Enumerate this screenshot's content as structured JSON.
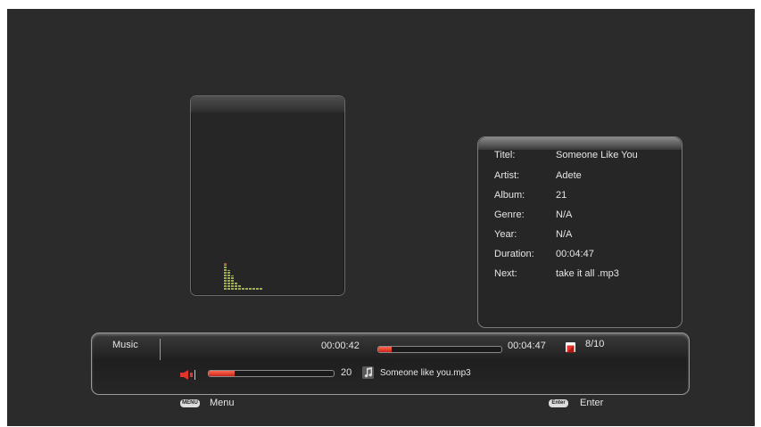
{
  "player": {
    "section_label": "Music",
    "elapsed": "00:00:42",
    "total": "00:04:47",
    "progress_fraction": 0.11,
    "track_position": "8/10",
    "volume": "20",
    "volume_fraction": 0.21,
    "filename": "Someone like you.mp3"
  },
  "info": {
    "rows": [
      {
        "label": "Titel:",
        "value": "Someone Like You"
      },
      {
        "label": "Artist:",
        "value": "Adete"
      },
      {
        "label": "Album:",
        "value": "21"
      },
      {
        "label": "Genre:",
        "value": "N/A"
      },
      {
        "label": "Year:",
        "value": "N/A"
      },
      {
        "label": "Duration:",
        "value": "00:04:47"
      },
      {
        "label": "Next:",
        "value": "take it all .mp3"
      }
    ]
  },
  "hints": {
    "menu_key": "MENU",
    "menu_label": "Menu",
    "enter_key": "Enter",
    "enter_label": "Enter"
  },
  "visualizer": {
    "levels": [
      0.7,
      0.55,
      0.4,
      0.22,
      0.12,
      0.08,
      0.05,
      0.04,
      0.03,
      0.03,
      0.02
    ]
  },
  "colors": {
    "accent": "#e2342a",
    "eq_green": "#9db33a",
    "background": "#2b2b2b"
  },
  "icons": {
    "speaker": "speaker-icon",
    "music_note": "music-note-icon",
    "playlist": "playlist-icon"
  }
}
